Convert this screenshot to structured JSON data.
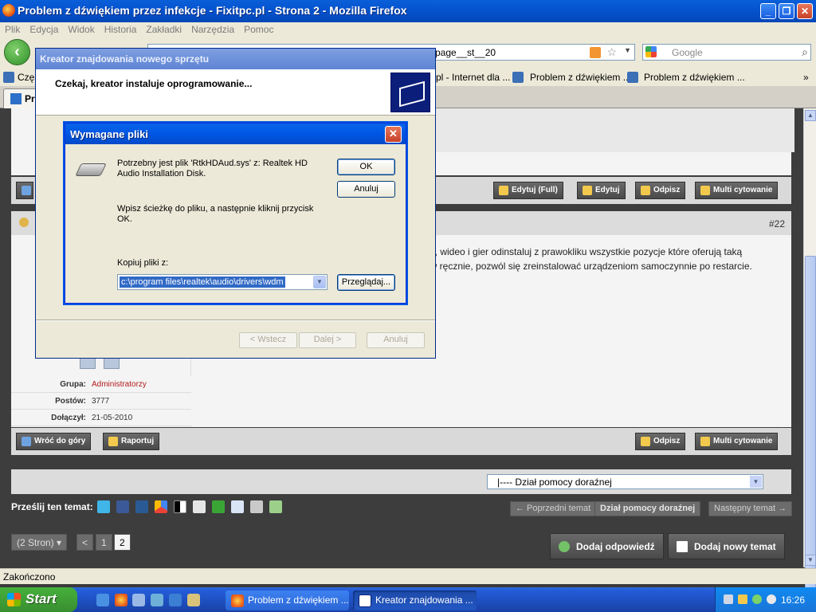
{
  "firefox": {
    "title": "Problem z dźwiękiem przez infekcje - Fixitpc.pl - Strona 2 - Mozilla Firefox",
    "menu": [
      "Plik",
      "Edycja",
      "Widok",
      "Historia",
      "Zakładki",
      "Narzędzia",
      "Pomoc"
    ],
    "url_visible": "e/page__st__20",
    "search_placeholder": "Google",
    "bookmarks": [
      "Częs",
      "pl - Internet dla ...",
      "Problem z dźwiękiem ...",
      "Problem z dźwiękiem ..."
    ],
    "tab_label": "Pr",
    "status": "Zakończono"
  },
  "forum": {
    "buttons_post1": [
      "Edytuj (Full)",
      "Edytuj",
      "Odpisz",
      "Multi cytowanie"
    ],
    "post_number": "#22",
    "post_text_line1": "ku, wideo i gier odinstaluj z prawokliku wszystkie pozycje które oferują taką",
    "post_text_line2": "ów ręcznie, pozwól się zreinstalować urządzeniom samoczynnie po restarcie.",
    "info": [
      {
        "label": "Grupa:",
        "value": "Administratorzy"
      },
      {
        "label": "Postów:",
        "value": "3777"
      },
      {
        "label": "Dołączył:",
        "value": "21-05-2010"
      }
    ],
    "bottom_left_buttons": [
      "Wróć do góry",
      "Raportuj"
    ],
    "bottom_right_buttons": [
      "Odpisz",
      "Multi cytowanie"
    ],
    "jump_select": "|---- Dział pomocy doraźnej",
    "share_label": "Prześlij ten temat:",
    "nav": [
      "← Poprzedni temat",
      "Dział pomocy doraźnej",
      "Następny temat →"
    ],
    "pages_label": "(2 Stron) ▾",
    "pages": [
      "<",
      "1",
      "2"
    ],
    "reply_button": "Dodaj odpowiedź",
    "new_topic_button": "Dodaj nowy temat"
  },
  "wizard": {
    "title": "Kreator znajdowania nowego sprzętu",
    "header": "Czekaj, kreator instaluje oprogramowanie...",
    "back": "< Wstecz",
    "next": "Dalej >",
    "cancel": "Anuluj"
  },
  "required_files": {
    "title": "Wymagane pliki",
    "message": "Potrzebny jest plik 'RtkHDAud.sys' z: Realtek HD Audio Installation Disk.",
    "instruction": "Wpisz ścieżkę do pliku, a następnie kliknij przycisk OK.",
    "copy_label": "Kopiuj pliki z:",
    "path_value": "c:\\program files\\realtek\\audio\\drivers\\wdm",
    "ok": "OK",
    "cancel": "Anuluj",
    "browse": "Przeglądaj..."
  },
  "taskbar": {
    "start": "Start",
    "items": [
      "Problem z dźwiękiem ...",
      "Kreator znajdowania ..."
    ],
    "clock": "16:26"
  }
}
